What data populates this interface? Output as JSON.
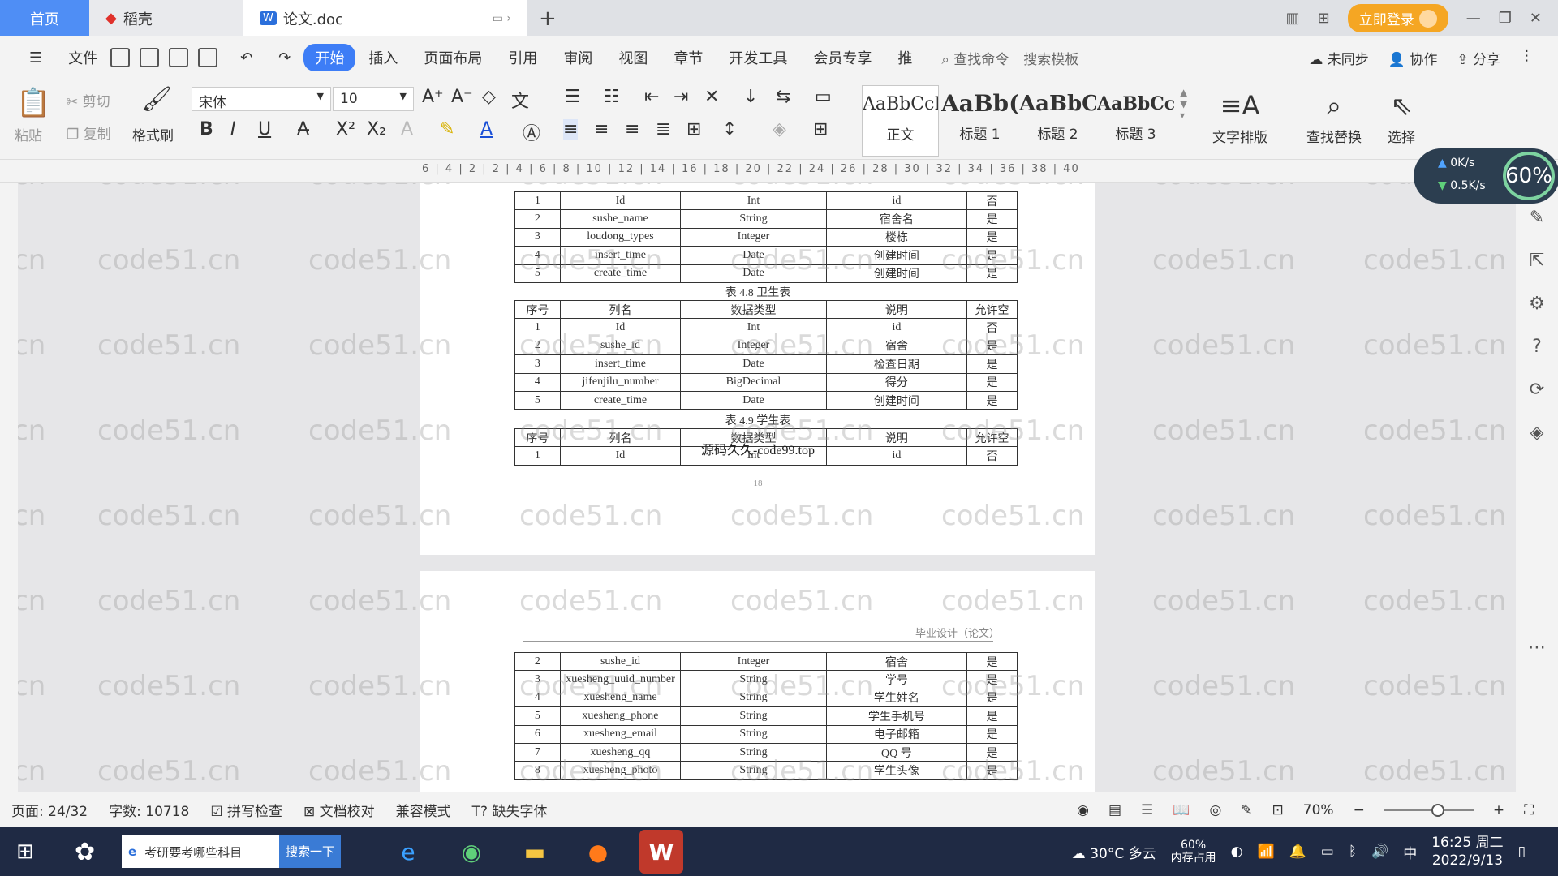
{
  "tabs": {
    "home": "首页",
    "daoke": "稻壳",
    "doc": "论文.doc"
  },
  "titlebar": {
    "login": "立即登录"
  },
  "ribbon_tabs": [
    "文件",
    "开始",
    "插入",
    "页面布局",
    "引用",
    "审阅",
    "视图",
    "章节",
    "开发工具",
    "会员专享",
    "推"
  ],
  "search": {
    "cmd": "查找命令",
    "template": "搜索模板"
  },
  "top_right": {
    "sync": "未同步",
    "collab": "协作",
    "share": "分享"
  },
  "clipboard": {
    "paste": "粘贴",
    "cut": "剪切",
    "copy": "复制",
    "format_painter": "格式刷"
  },
  "font": {
    "name": "宋体",
    "size": "10"
  },
  "styles": [
    {
      "preview": "AaBbCcI",
      "name": "正文"
    },
    {
      "preview": "AaBb(",
      "name": "标题 1"
    },
    {
      "preview": "AaBbC",
      "name": "标题 2"
    },
    {
      "preview": "AaBbCcl",
      "name": "标题 3"
    }
  ],
  "tools": {
    "text_layout": "文字排版",
    "find_replace": "查找替换",
    "select": "选择"
  },
  "ruler": "6 | 4 | 2 | 2 | 4 | 6 | 8 | 10 | 12 | 14 | 16 | 18 | 20 | 22 | 24 | 26 | 28 | 30 | 32 | 34 | 36 | 38 | 40",
  "speed": {
    "up": "0K/s",
    "down": "0.5K/s",
    "percent": "60%"
  },
  "table_top": [
    [
      "1",
      "Id",
      "Int",
      "id",
      "否"
    ],
    [
      "2",
      "sushe_name",
      "String",
      "宿舍名",
      "是"
    ],
    [
      "3",
      "loudong_types",
      "Integer",
      "楼栋",
      "是"
    ],
    [
      "4",
      "insert_time",
      "Date",
      "创建时间",
      "是"
    ],
    [
      "5",
      "create_time",
      "Date",
      "创建时间",
      "是"
    ]
  ],
  "caption_48": "表 4.8 卫生表",
  "table_48": [
    [
      "序号",
      "列名",
      "数据类型",
      "说明",
      "允许空"
    ],
    [
      "1",
      "Id",
      "Int",
      "id",
      "否"
    ],
    [
      "2",
      "sushe_id",
      "Integer",
      "宿舍",
      "是"
    ],
    [
      "3",
      "insert_time",
      "Date",
      "检查日期",
      "是"
    ],
    [
      "4",
      "jifenjilu_number",
      "BigDecimal",
      "得分",
      "是"
    ],
    [
      "5",
      "create_time",
      "Date",
      "创建时间",
      "是"
    ]
  ],
  "caption_49": "表 4.9 学生表",
  "table_49": [
    [
      "序号",
      "列名",
      "数据类型",
      "说明",
      "允许空"
    ],
    [
      "1",
      "Id",
      "Int",
      "id",
      "否"
    ]
  ],
  "overlay_watermark": "源码久久-code99.top",
  "page_number": "18",
  "header_text": "毕业设计（论文）",
  "table_next": [
    [
      "2",
      "sushe_id",
      "Integer",
      "宿舍",
      "是"
    ],
    [
      "3",
      "xuesheng_uuid_number",
      "String",
      "学号",
      "是"
    ],
    [
      "4",
      "xuesheng_name",
      "String",
      "学生姓名",
      "是"
    ],
    [
      "5",
      "xuesheng_phone",
      "String",
      "学生手机号",
      "是"
    ],
    [
      "6",
      "xuesheng_email",
      "String",
      "电子邮箱",
      "是"
    ],
    [
      "7",
      "xuesheng_qq",
      "String",
      "QQ 号",
      "是"
    ],
    [
      "8",
      "xuesheng_photo",
      "String",
      "学生头像",
      "是"
    ]
  ],
  "watermark": "code51.cn",
  "status": {
    "page": "页面: 24/32",
    "words": "字数: 10718",
    "spell": "拼写检查",
    "proof": "文档校对",
    "compat": "兼容模式",
    "missing_font": "缺失字体",
    "zoom": "70%"
  },
  "taskbar": {
    "search_text": "考研要考哪些科目",
    "search_btn": "搜索一下",
    "weather": "30°C 多云",
    "mem": "60%",
    "mem_label": "内存占用",
    "ime": "中",
    "time": "16:25 周二",
    "date": "2022/9/13"
  }
}
